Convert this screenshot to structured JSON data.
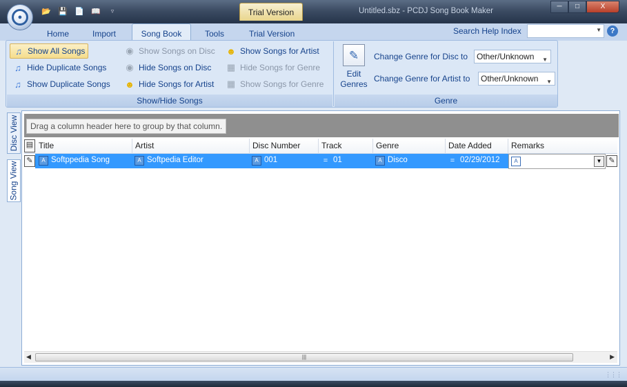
{
  "window": {
    "title": "Untitled.sbz - PCDJ Song Book Maker",
    "trial_badge": "Trial Version",
    "buttons": {
      "minimize": "─",
      "maximize": "□",
      "close": "X"
    }
  },
  "quick_access": [
    "open-folder-icon",
    "save-icon",
    "new-document-icon",
    "book-icon",
    "customize-dropdown-icon"
  ],
  "tabs": [
    {
      "label": "Home"
    },
    {
      "label": "Import"
    },
    {
      "label": "Song Book",
      "active": true
    },
    {
      "label": "Tools"
    },
    {
      "label": "Trial Version"
    }
  ],
  "help": {
    "label": "Search Help Index",
    "placeholder": "",
    "icon": "help-icon"
  },
  "ribbon": {
    "show_hide": {
      "group_label": "Show/Hide Songs",
      "buttons": [
        {
          "label": "Show All Songs",
          "icon": "music-note-icon",
          "selected": true,
          "enabled": true
        },
        {
          "label": "Hide Duplicate Songs",
          "icon": "music-note-icon",
          "enabled": true
        },
        {
          "label": "Show Duplicate Songs",
          "icon": "music-note-icon",
          "enabled": true
        },
        {
          "label": "Show Songs on Disc",
          "icon": "disc-icon",
          "enabled": false
        },
        {
          "label": "Hide Songs on Disc",
          "icon": "disc-icon",
          "enabled": false
        },
        {
          "label": "Hide Songs for Artist",
          "icon": "smiley-icon",
          "enabled": false
        },
        {
          "label": "Show Songs for Artist",
          "icon": "smiley-icon",
          "enabled": true
        },
        {
          "label": "Hide Songs for Genre",
          "icon": "grid-icon",
          "enabled": false
        },
        {
          "label": "Show Songs for Genre",
          "icon": "grid-icon",
          "enabled": false
        }
      ]
    },
    "genre": {
      "group_label": "Genre",
      "edit_genres_label_1": "Edit",
      "edit_genres_label_2": "Genres",
      "disc_label": "Change Genre for Disc to",
      "disc_value": "Other/Unknown",
      "artist_label": "Change Genre for Artist to",
      "artist_value": "Other/Unknown"
    }
  },
  "side_tabs": [
    {
      "label": "Disc View"
    },
    {
      "label": "Song View",
      "active": true
    }
  ],
  "grid": {
    "group_by_text": "Drag a column header here to group by that column.",
    "columns": [
      "Title",
      "Artist",
      "Disc Number",
      "Track",
      "Genre",
      "Date Added",
      "Remarks"
    ],
    "rows": [
      {
        "title": "Softppedia Song",
        "artist": "Softpedia Editor",
        "disc_number": "001",
        "track": "01",
        "genre": "Disco",
        "date_added": "02/29/2012",
        "remarks": ""
      }
    ]
  },
  "colors": {
    "selection": "#3399ff",
    "ribbon_text": "#15428b",
    "ribbon_bg": "#dbe7f6",
    "title_bar": "#3c4c63"
  }
}
